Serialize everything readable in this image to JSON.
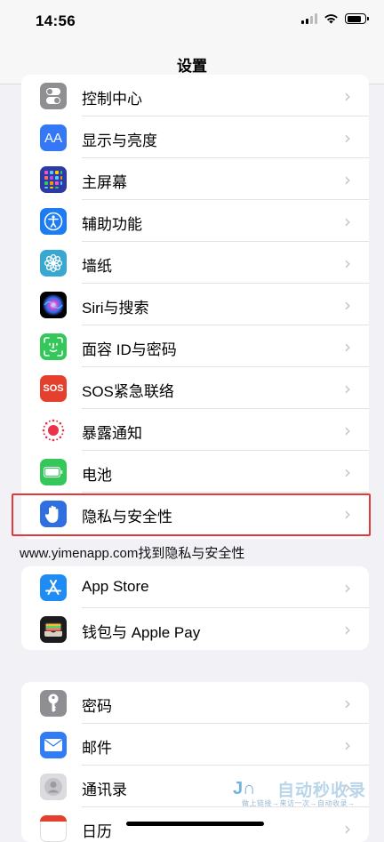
{
  "status": {
    "time": "14:56"
  },
  "nav": {
    "title": "设置"
  },
  "group1": [
    {
      "label": "控制中心",
      "icon": "toggle-icon",
      "color": "#8e8e93"
    },
    {
      "label": "显示与亮度",
      "icon": "display-aa-icon",
      "color": "#3478f6"
    },
    {
      "label": "主屏幕",
      "icon": "app-grid-icon",
      "color": "#2c3aa5"
    },
    {
      "label": "辅助功能",
      "icon": "accessibility-icon",
      "color": "#1e7cf2"
    },
    {
      "label": "墙纸",
      "icon": "flower-icon",
      "color": "#38a8d0"
    },
    {
      "label": "Siri与搜索",
      "icon": "siri-icon",
      "color": "#1b1b2e"
    },
    {
      "label": "面容 ID与密码",
      "icon": "face-id-icon",
      "color": "#34c759"
    },
    {
      "label": "SOS紧急联络",
      "icon": "sos-icon",
      "color": "#e5402d"
    },
    {
      "label": "暴露通知",
      "icon": "exposure-icon",
      "color": "#ffffff"
    },
    {
      "label": "电池",
      "icon": "battery-icon",
      "color": "#34c759"
    },
    {
      "label": "隐私与安全性",
      "icon": "hand-icon",
      "color": "#2f6fe0"
    }
  ],
  "group1_partial_label": "控制中心",
  "icon_text": {
    "aa": "AA",
    "sos": "SOS"
  },
  "caption": "www.yimenapp.com找到隐私与安全性",
  "group2": [
    {
      "label": "App Store",
      "icon": "app-store-icon",
      "color": "#1f8cf5"
    },
    {
      "label": "钱包与 Apple Pay",
      "icon": "wallet-icon",
      "color": "#1c1c1e"
    }
  ],
  "group3": [
    {
      "label": "密码",
      "icon": "key-icon",
      "color": "#8e8e93"
    },
    {
      "label": "邮件",
      "icon": "mail-icon",
      "color": "#2f7cf6"
    },
    {
      "label": "通讯录",
      "icon": "contacts-icon",
      "color": "#c9c9cd"
    },
    {
      "label": "日历",
      "icon": "calendar-icon",
      "color": "#ffffff"
    }
  ],
  "watermark": {
    "title": "自动秒收录",
    "sub": "做上链接→来访一次→自动收录→"
  },
  "colors": {
    "highlight": "#e23a3a",
    "background": "#f2f2f6"
  }
}
